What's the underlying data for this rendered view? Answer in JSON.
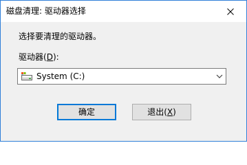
{
  "window": {
    "title": "磁盘清理: 驱动器选择"
  },
  "dialog": {
    "instruction": "选择要清理的驱动器。",
    "drive_label_prefix": "驱动器(",
    "drive_label_mnemonic": "D",
    "drive_label_suffix": "):",
    "selected_drive": "System (C:)",
    "drive_icon": "hard-drive-icon"
  },
  "buttons": {
    "ok_label": "确定",
    "exit_label_prefix": "退出(",
    "exit_label_mnemonic": "X",
    "exit_label_suffix": ")"
  },
  "colors": {
    "window_border": "#2f7fd8",
    "focus_blue": "#0078d7",
    "dialog_background": "#f0f0f0",
    "button_face": "#e1e1e1"
  }
}
